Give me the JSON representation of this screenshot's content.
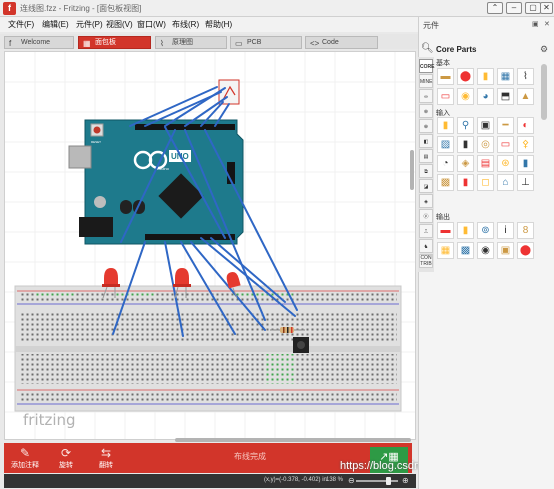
{
  "window": {
    "logo": "f",
    "title": "连线图.fzz - Fritzing - [面包板视图]",
    "controls": [
      "⌃",
      "–",
      "▢",
      "✕"
    ]
  },
  "menu": [
    "文件(F)",
    "编辑(E)",
    "元件(P)",
    "视图(V)",
    "窗口(W)",
    "布线(R)",
    "帮助(H)"
  ],
  "tabs": [
    {
      "label": "Welcome",
      "icon": "f"
    },
    {
      "label": "面包板",
      "icon": "▦",
      "active": true
    },
    {
      "label": "原理图",
      "icon": "⌇"
    },
    {
      "label": "PCB",
      "icon": "▭"
    },
    {
      "label": "Code",
      "icon": "<>"
    }
  ],
  "canvas": {
    "logo_text": "fritzing",
    "board": {
      "brand": "Arduino",
      "model": "UNO",
      "reset_label": "RESET"
    }
  },
  "bottom_bar": {
    "add_note": "添加注释",
    "rotate": "旋转",
    "flip": "翻转",
    "routing_status": "布线完成",
    "share_icon": "↗▦"
  },
  "status_bar": {
    "coords": "(x,y)=(-0.378, -0.402) in",
    "zoom": "138 %"
  },
  "watermark": "https://blog.csdn.net/only_tao",
  "parts": {
    "dock_title": "元件",
    "dock_controls": [
      "▣",
      "✕"
    ],
    "header": "Core Parts",
    "bins": [
      "CORE",
      "MINE",
      "∞",
      "⊛",
      "⊕",
      "◧",
      "▤",
      "⧉",
      "◪",
      "◈",
      "ⓟ",
      "⎍",
      "♞",
      "CON TRIB"
    ],
    "sections": [
      "基本",
      "输入",
      "输出"
    ],
    "rows": [
      [
        "▬",
        "⬤",
        "▮",
        "▦",
        "⌇"
      ],
      [
        "▭",
        "◉",
        "◕",
        "⬒",
        "▲"
      ],
      [
        "▮",
        "⚲",
        "▣",
        "━",
        "◐"
      ],
      [
        "▨",
        "▮",
        "◎",
        "▭",
        "⚴"
      ],
      [
        "◔",
        "◈",
        "▤",
        "⊛",
        "▮"
      ],
      [
        "▩",
        "▮",
        "◻",
        "⌂",
        "⊥"
      ],
      [
        "▬",
        "▮",
        "⊚",
        "ⅰ",
        "8"
      ],
      [
        "▦",
        "▩",
        "◉",
        "▣",
        "⬤"
      ]
    ],
    "colors": [
      "#c94",
      "#e33",
      "#fb3",
      "#37a",
      "#333"
    ]
  }
}
